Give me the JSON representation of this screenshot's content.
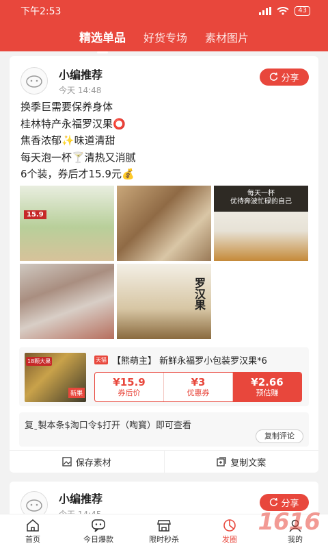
{
  "status": {
    "time": "下午2:53",
    "battery": "43"
  },
  "tabs": [
    "精选单品",
    "好货专场",
    "素材图片"
  ],
  "post1": {
    "author": "小编推荐",
    "time": "今天 14:48",
    "share": "分享",
    "lines": [
      "换季巨需要保养身体",
      "桂林特产永福罗汉果⭕",
      "焦香浓郁✨味道清甜",
      "每天泡一杯🍸清热又消腻",
      "6个装，券后才15.9元💰"
    ],
    "image_texts": {
      "p1_tag": "15.9",
      "p3_caption": "每天一杯\n优待奔波忙碌的自己",
      "p5_caption": "罗汉果"
    },
    "product": {
      "shop": "天猫",
      "title": "【熊萌主】 新鲜永福罗小包装罗汉果*6",
      "thumb_badge": "18颗大果",
      "thumb_badge2": "新果",
      "price_after": "¥15.9",
      "price_after_label": "券后价",
      "coupon": "¥3",
      "coupon_label": "优惠券",
      "earn": "¥2.66",
      "earn_label": "预估赚"
    },
    "code_text": "复ˍ製本条$淘口令$打开（啕寳）即可查看",
    "copy_comment": "复制评论",
    "save_material": "保存素材",
    "copy_text": "复制文案"
  },
  "post2": {
    "author": "小编推荐",
    "time": "今天 14:45",
    "share": "分享"
  },
  "nav": [
    "首页",
    "今日爆款",
    "限时秒杀",
    "发圈",
    "我的"
  ],
  "watermark": "1616"
}
